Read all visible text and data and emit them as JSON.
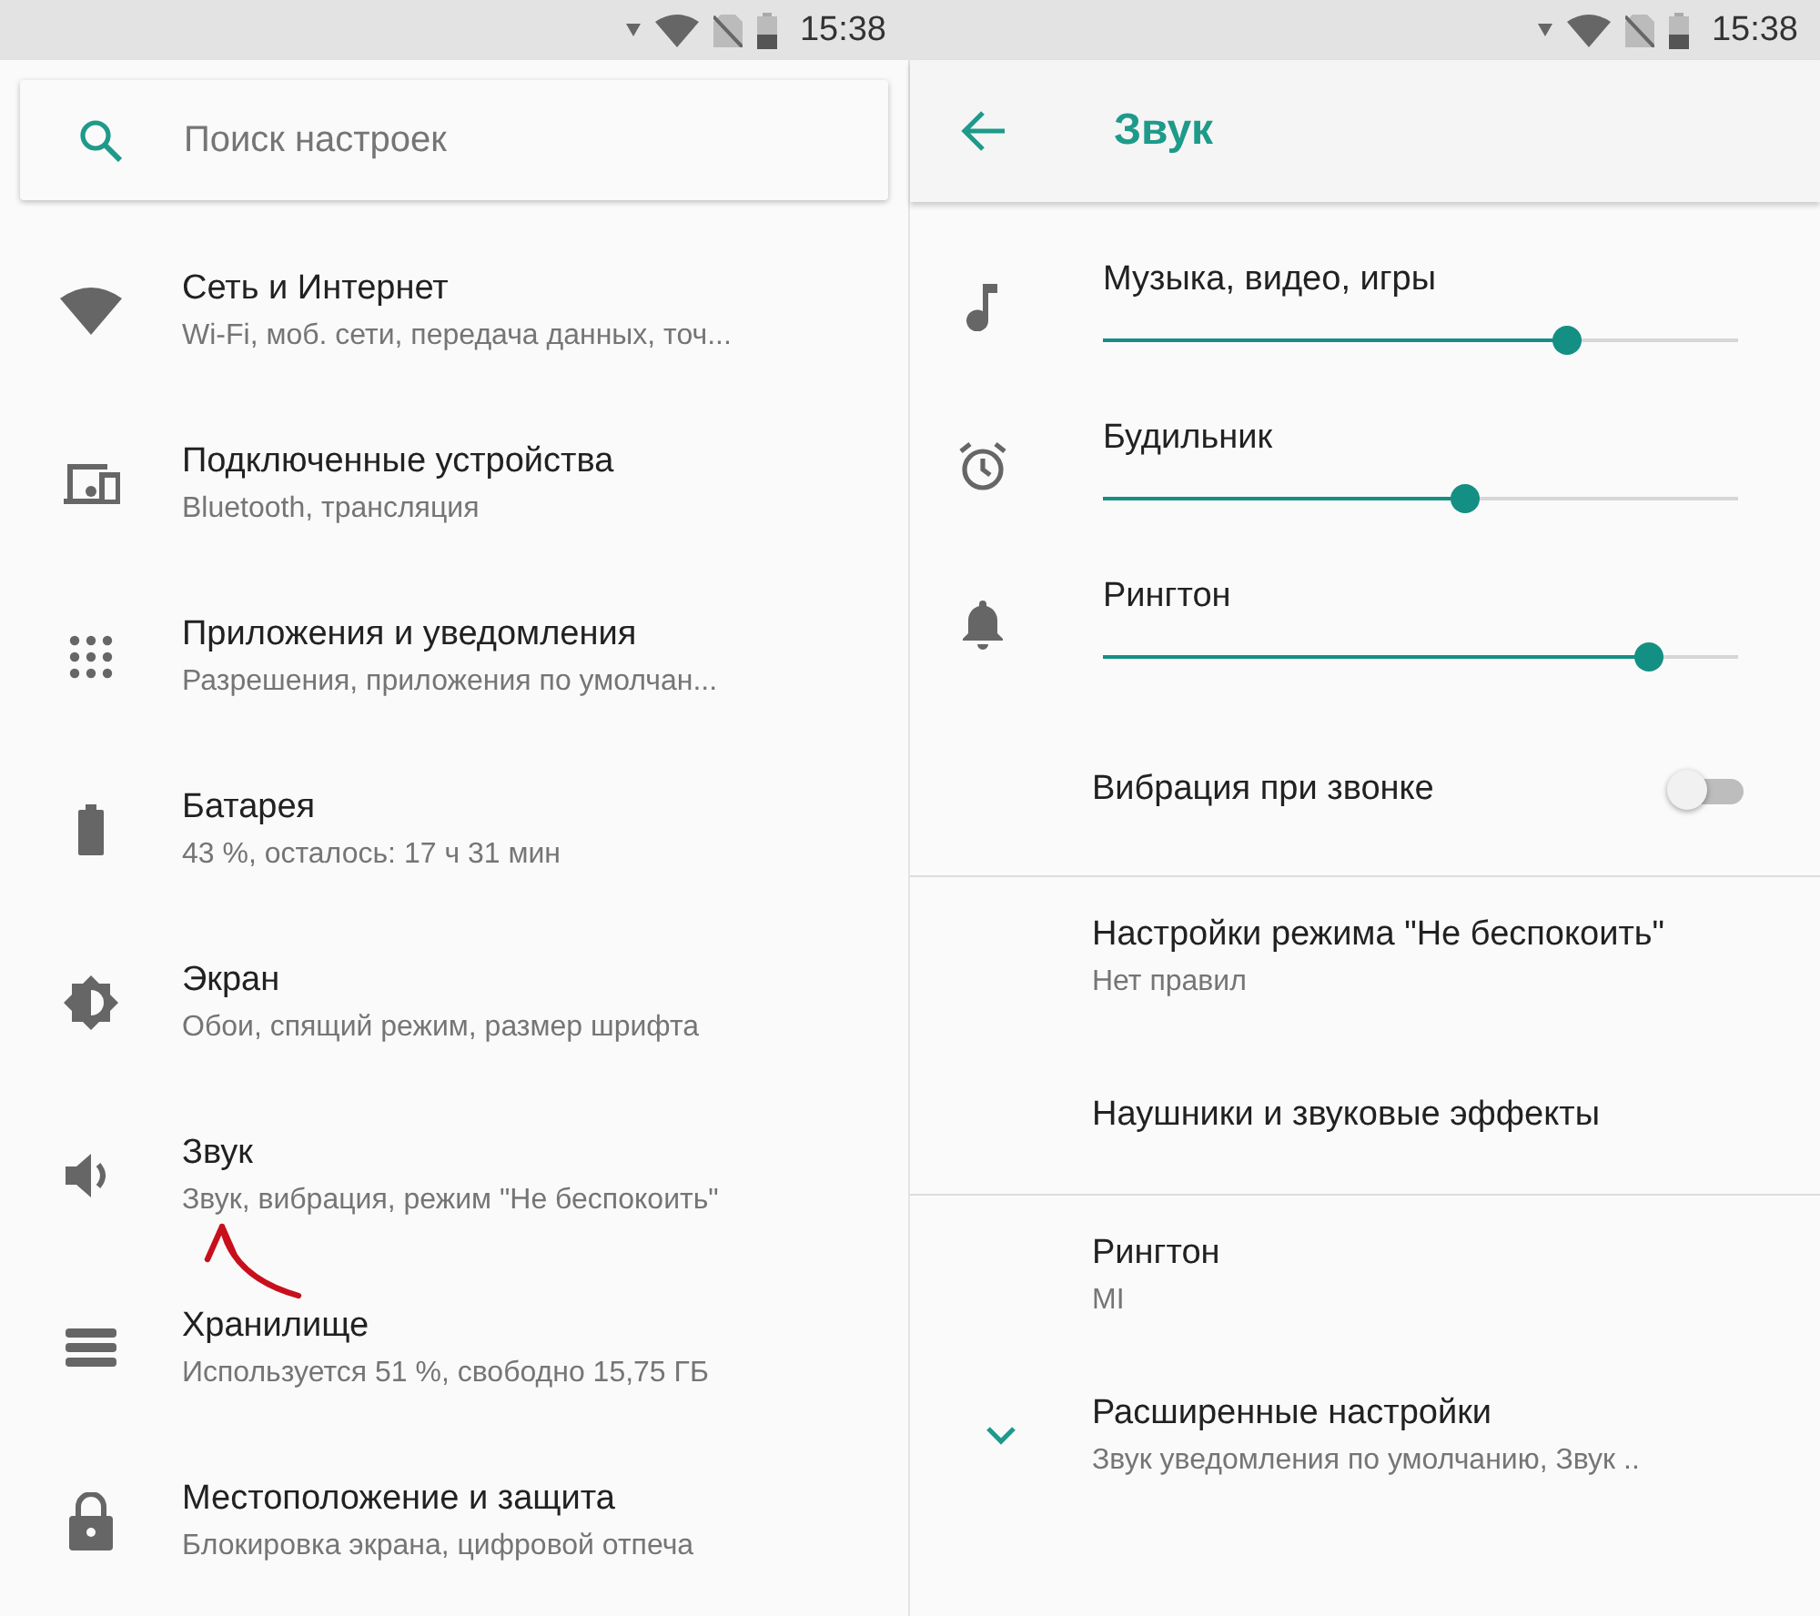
{
  "left_status_bar": {
    "time": "15:38"
  },
  "settings": {
    "search": {
      "placeholder": "Поиск настроек"
    },
    "items": [
      {
        "kind": "wifi",
        "title": "Сеть и Интернет",
        "subtitle": "Wi-Fi, моб. сети, передача данных, точ..."
      },
      {
        "kind": "devices",
        "title": "Подключенные устройства",
        "subtitle": "Bluetooth, трансляция"
      },
      {
        "kind": "apps",
        "title": "Приложения и уведомления",
        "subtitle": "Разрешения, приложения по умолчан..."
      },
      {
        "kind": "battery",
        "title": "Батарея",
        "subtitle": "43 %, осталось: 17 ч 31 мин"
      },
      {
        "kind": "display",
        "title": "Экран",
        "subtitle": "Обои, спящий режим, размер шрифта"
      },
      {
        "kind": "sound",
        "title": "Звук",
        "subtitle": "Звук, вибрация, режим \"Не беспокоить\""
      },
      {
        "kind": "storage",
        "title": "Хранилище",
        "subtitle": "Используется 51 %, свободно 15,75 ГБ"
      },
      {
        "kind": "lock",
        "title": "Местоположение и защита",
        "subtitle": "Блокировка экрана, цифровой отпеча"
      }
    ]
  },
  "right_status_bar": {
    "time": "15:38"
  },
  "sound": {
    "title": "Звук",
    "sliders": [
      {
        "kind": "music",
        "label": "Музыка, видео, игры",
        "level": 0.73
      },
      {
        "kind": "alarm",
        "label": "Будильник",
        "level": 0.57
      },
      {
        "kind": "bell",
        "label": "Рингтон",
        "level": 0.86
      }
    ],
    "vibration": {
      "label": "Вибрация при звонке",
      "on": false
    },
    "groups": [
      [
        {
          "title": "Настройки режима \"Не беспокоить\"",
          "subtitle": "Нет правил"
        },
        {
          "title": "Наушники и звуковые эффекты"
        }
      ],
      [
        {
          "title": "Рингтон",
          "subtitle": "MI"
        },
        {
          "title": "Расширенные настройки",
          "subtitle": "Звук уведомления по умолчанию, Звук ..",
          "expandable": true
        }
      ]
    ]
  }
}
